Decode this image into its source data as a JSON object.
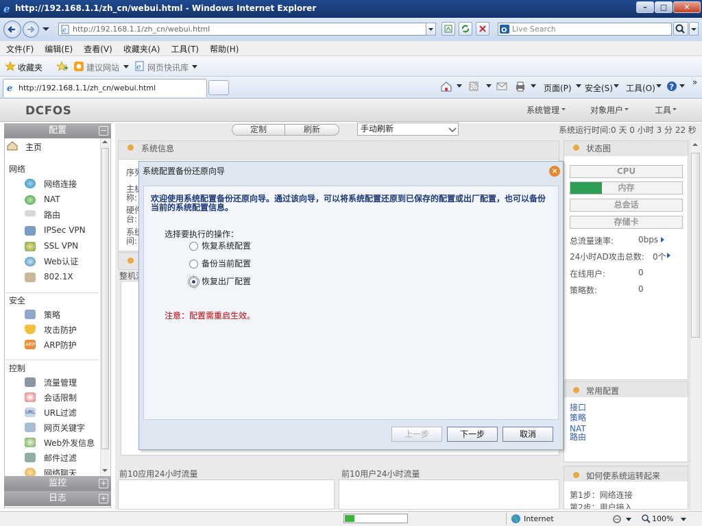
{
  "window": {
    "title": "http://192.168.1.1/zh_cn/webui.html - Windows Internet Explorer",
    "minimize": "–",
    "maximize": "□",
    "close": "✕"
  },
  "address": {
    "url": "http://192.168.1.1/zh_cn/webui.html",
    "search_placeholder": "Live Search"
  },
  "menubar": [
    "文件(F)",
    "编辑(E)",
    "查看(V)",
    "收藏夹(A)",
    "工具(T)",
    "帮助(H)"
  ],
  "favorites": {
    "label": "收藏夹",
    "suggested": "建议网站",
    "slice": "网页快讯库"
  },
  "tab": {
    "label": "http://192.168.1.1/zh_cn/webui.html"
  },
  "commandbar": {
    "page": "页面(P)",
    "safety": "安全(S)",
    "tools": "工具(O)",
    "more": "»"
  },
  "app": {
    "logo": "DCFOS",
    "topmenu": [
      "系统管理",
      "对象用户",
      "工具"
    ],
    "toolbar": {
      "customize": "定制",
      "refresh": "刷新",
      "refresh_mode": "手动刷新"
    },
    "uptime": "系统运行时间:0 天 0 小时 3 分 22 秒"
  },
  "sidebar": {
    "config_header": "配置",
    "home": "主页",
    "network_title": "网络",
    "network": [
      "网络连接",
      "NAT",
      "路由",
      "IPSec VPN",
      "SSL VPN",
      "Web认证",
      "802.1X"
    ],
    "security_title": "安全",
    "security": [
      "策略",
      "攻击防护",
      "ARP防护"
    ],
    "control_title": "控制",
    "control": [
      "流量管理",
      "会话限制",
      "URL过滤",
      "网页关键字",
      "Web外发信息",
      "邮件过滤",
      "网络聊天"
    ],
    "monitor_header": "监控",
    "log_header": "日志",
    "collapse": "−",
    "expand": "+"
  },
  "panels": {
    "sysinfo_title": "系统信息",
    "sysinfo_fragments": [
      "序列",
      "主机",
      "称:",
      "硬件",
      "台:",
      "系统",
      "间:"
    ],
    "whole_frag": "整机流",
    "top_apps": "前10应用24小时流量",
    "top_users": "前10用户24小时流量",
    "status_title": "状态图",
    "gauges": [
      {
        "label": "CPU",
        "fill": 0.0
      },
      {
        "label": "内存",
        "fill": 0.28
      },
      {
        "label": "总会话",
        "fill": 0.0
      },
      {
        "label": "存储卡",
        "fill": 0.0
      }
    ],
    "stats": [
      {
        "label": "总流量速率:",
        "value": "0bps"
      },
      {
        "label": "24小时AD攻击总数:",
        "value": "0个"
      },
      {
        "label": "在线用户:",
        "value": "0"
      },
      {
        "label": "策略数:",
        "value": "0"
      }
    ],
    "common_title": "常用配置",
    "common_links": [
      "接口",
      "策略",
      "NAT",
      "路由"
    ],
    "howto_title": "如何使系统运转起来",
    "howto_steps": [
      "第1步：网络连接",
      "第2步：用户接入"
    ]
  },
  "dialog": {
    "title": "系统配置备份还原向导",
    "intro": "欢迎使用系统配置备份还原向导。通过该向导，可以将系统配置还原到已保存的配置或出厂配置，也可以备份当前的系统配置信息。",
    "prompt": "选择要执行的操作：",
    "options": [
      "恢复系统配置",
      "备份当前配置",
      "恢复出厂配置"
    ],
    "selected_index": 2,
    "note": "注意：配置需重启生效。",
    "buttons": {
      "prev": "上一步",
      "next": "下一步",
      "cancel": "取消"
    }
  },
  "statusbar": {
    "zone": "Internet",
    "zoom": "100%",
    "progress": 0.15
  }
}
